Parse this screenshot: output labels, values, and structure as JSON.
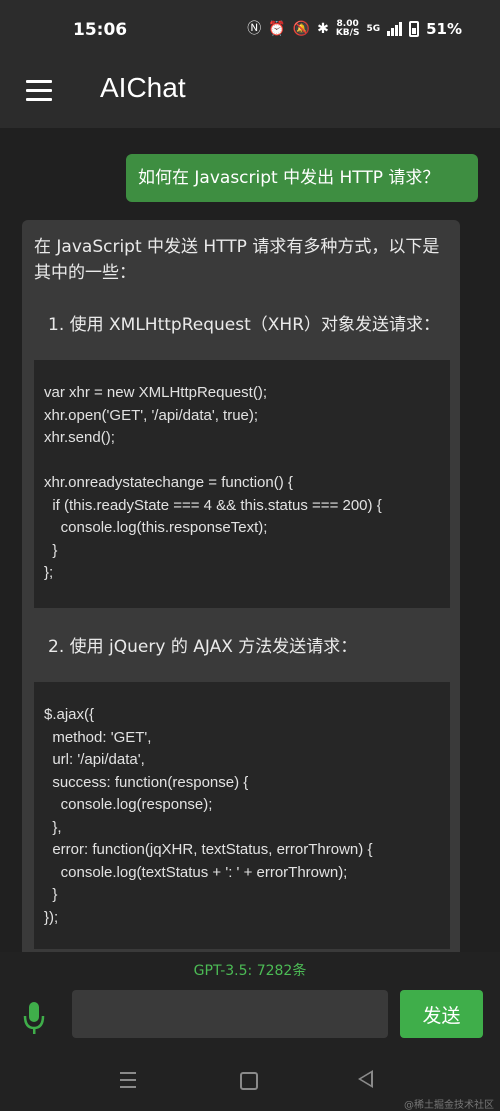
{
  "status_bar": {
    "time": "15:06",
    "net_speed_value": "8.00",
    "net_speed_unit": "KB/S",
    "network": "5G",
    "battery": "51%",
    "icons": [
      "nfc-icon",
      "alarm-icon",
      "mute-icon",
      "bluetooth-icon",
      "signal-icon",
      "battery-icon"
    ]
  },
  "app_bar": {
    "title": "AIChat",
    "menu_icon": "hamburger-icon"
  },
  "chat": {
    "user_message": "如何在 Javascript 中发出 HTTP 请求？",
    "bot_intro": "在 JavaScript 中发送 HTTP 请求有多种方式，以下是其中的一些：",
    "steps": [
      {
        "label": "1. 使用 XMLHttpRequest（XHR）对象发送请求：",
        "code_lines": [
          "var xhr = new XMLHttpRequest();",
          "xhr.open('GET', '/api/data', true);",
          "xhr.send();",
          "",
          "xhr.onreadystatechange = function() {",
          "  if (this.readyState === 4 && this.status === 200) {",
          "    console.log(this.responseText);",
          "  }",
          "};"
        ]
      },
      {
        "label": "2. 使用 jQuery 的 AJAX 方法发送请求：",
        "code_lines": [
          "$.ajax({",
          "  method: 'GET',",
          "  url: '/api/data',",
          "  success: function(response) {",
          "    console.log(response);",
          "  },",
          "  error: function(jqXHR, textStatus, errorThrown) {",
          "    console.log(textStatus + ': ' + errorThrown);",
          "  }",
          "});"
        ]
      }
    ]
  },
  "bottom": {
    "quota": "GPT-3.5: 7282条",
    "input_value": "",
    "send_label": "发送",
    "mic_icon": "microphone-icon",
    "accent_color": "#3fae4a"
  },
  "watermark": "@稀土掘金技术社区"
}
